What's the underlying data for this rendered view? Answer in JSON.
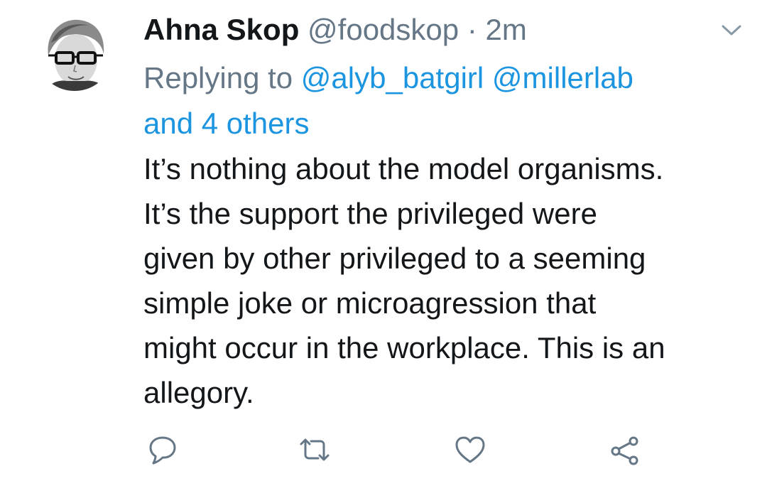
{
  "tweet": {
    "author": {
      "display_name": "Ahna Skop",
      "handle": "@foodskop"
    },
    "separator": "·",
    "timestamp": "2m",
    "reply": {
      "prefix": "Replying to",
      "mentions": [
        "@alyb_batgirl",
        "@millerlab"
      ],
      "others": "and 4 others"
    },
    "lines": [
      "It’s nothing about the model organisms.",
      "It’s the support the privileged were",
      "given by other privileged to a seeming",
      "simple joke or microagression that",
      "might occur in the workplace. This is an",
      "allegory."
    ]
  },
  "icons": {
    "menu": "chevron-down-icon",
    "reply": "reply-icon",
    "retweet": "retweet-icon",
    "like": "heart-icon",
    "share": "share-icon"
  },
  "colors": {
    "name": "#14171a",
    "muted": "#657786",
    "link": "#1b95e0",
    "icon": "#657786"
  }
}
